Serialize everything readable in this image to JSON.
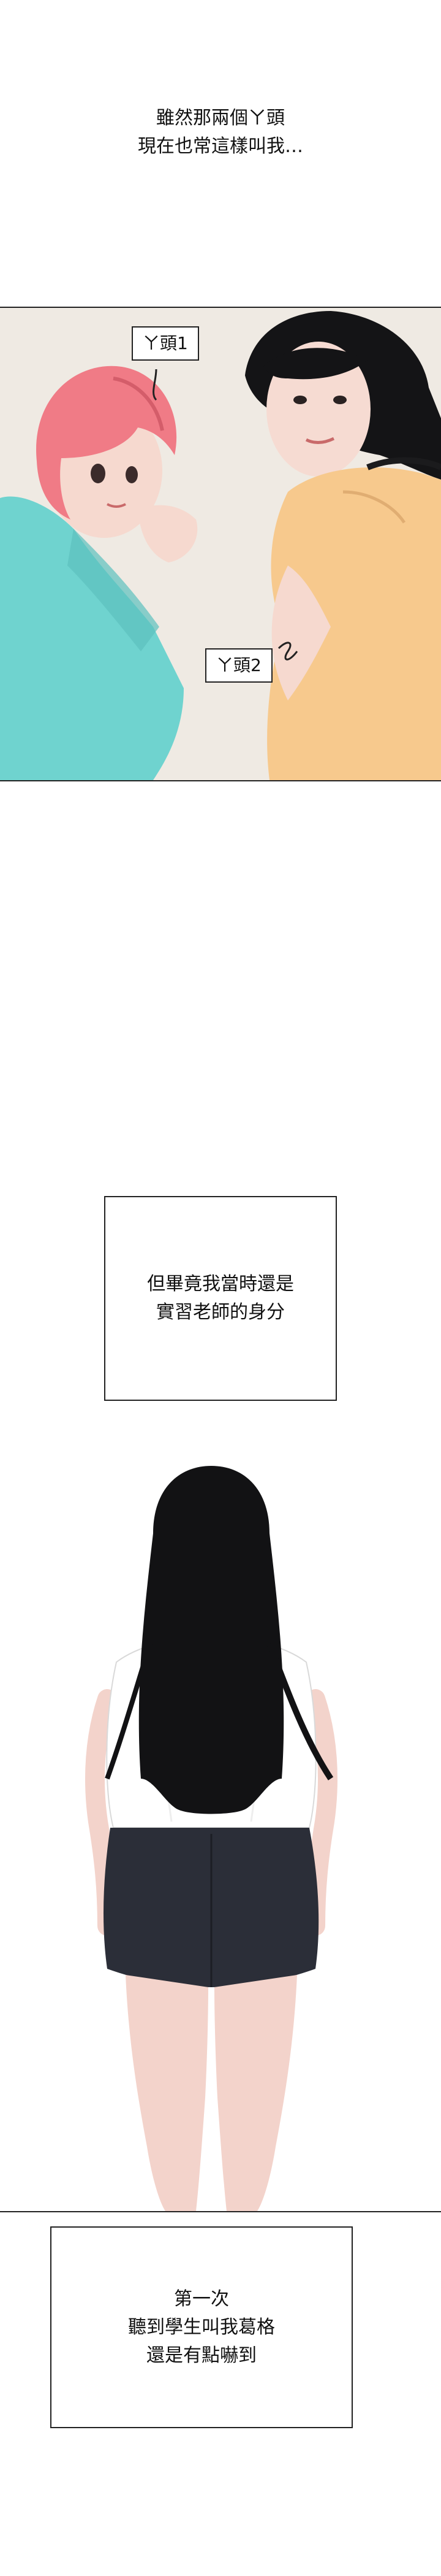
{
  "narration_top": [
    "雖然那兩個ㄚ頭",
    "現在也常這樣叫我…"
  ],
  "panel_tags": {
    "tag1": "ㄚ頭1",
    "tag2": "ㄚ頭2"
  },
  "caption_middle": [
    "但畢竟我當時還是",
    "實習老師的身分"
  ],
  "caption_bottom": [
    "第一次",
    "聽到學生叫我葛格",
    "還是有點嚇到"
  ],
  "colors": {
    "bg_top_panel": "#f2eee8",
    "pink_hair": "#f07b86",
    "teal_top": "#6fd0cf",
    "yellow_top": "#f6c98d",
    "skirt": "#2b2e38",
    "hair_dark": "#121214",
    "skin": "#f5d7cf"
  }
}
